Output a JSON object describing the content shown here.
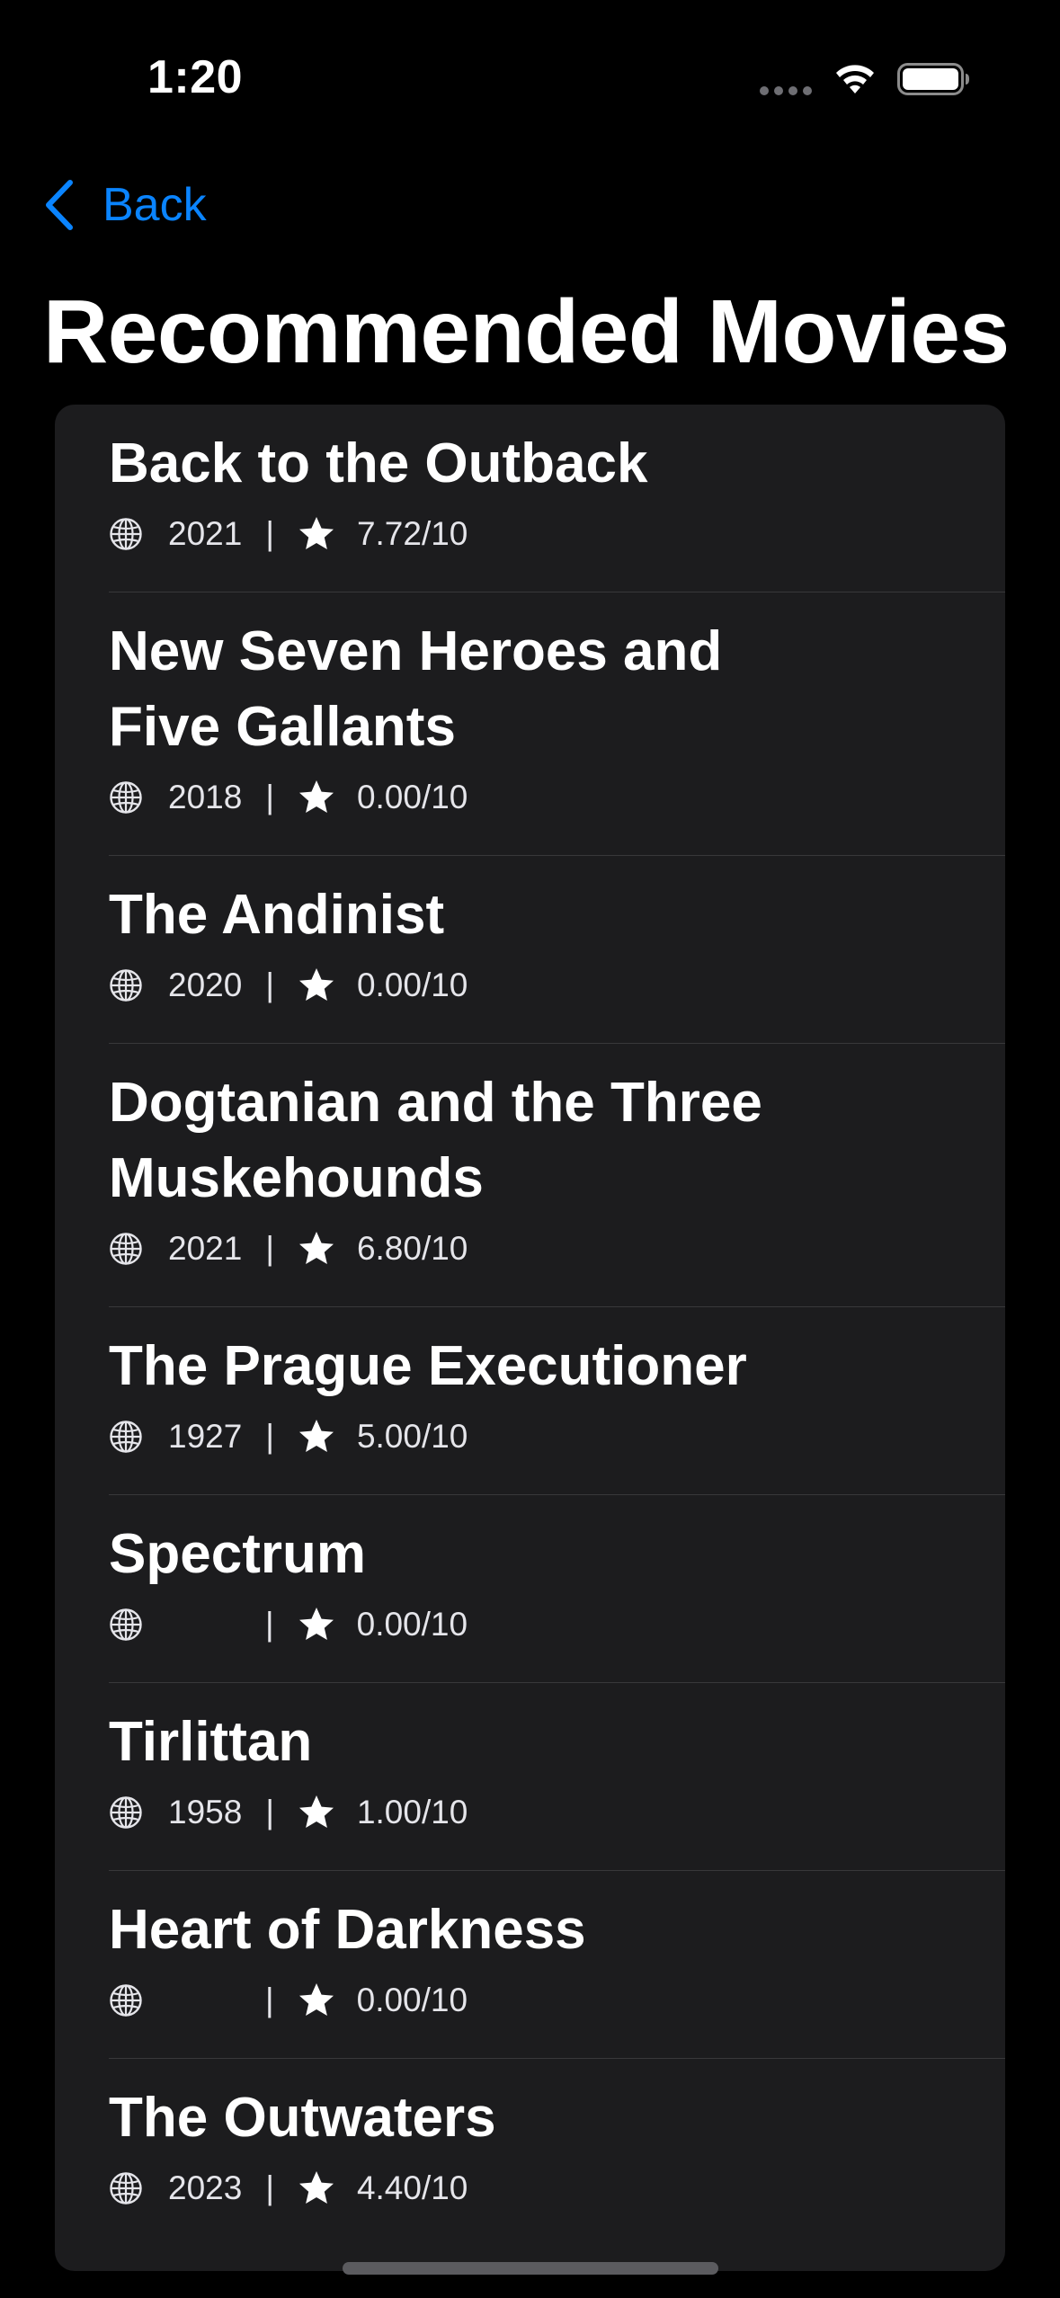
{
  "status_bar": {
    "time": "1:20"
  },
  "nav": {
    "back_label": "Back",
    "title": "Recommended Movies"
  },
  "colors": {
    "accent": "#0a84ff",
    "background": "#000000",
    "card": "#1c1c1e",
    "separator": "#38383a"
  },
  "icons": {
    "meta_left": "globe-icon",
    "meta_rating": "star-icon"
  },
  "movies": [
    {
      "title": "Back to the Outback",
      "year": "2021",
      "separator": "|",
      "rating": "7.72/10"
    },
    {
      "title": "New Seven Heroes and Five Gallants",
      "year": "2018",
      "separator": "|",
      "rating": "0.00/10"
    },
    {
      "title": "The Andinist",
      "year": "2020",
      "separator": "|",
      "rating": "0.00/10"
    },
    {
      "title": "Dogtanian and the Three Muskehounds",
      "year": "2021",
      "separator": "|",
      "rating": "6.80/10"
    },
    {
      "title": "The Prague Executioner",
      "year": "1927",
      "separator": "|",
      "rating": "5.00/10"
    },
    {
      "title": "Spectrum",
      "year": "",
      "separator": "|",
      "rating": "0.00/10"
    },
    {
      "title": "Tirlittan",
      "year": "1958",
      "separator": "|",
      "rating": "1.00/10"
    },
    {
      "title": "Heart of Darkness",
      "year": "",
      "separator": "|",
      "rating": "0.00/10"
    },
    {
      "title": "The Outwaters",
      "year": "2023",
      "separator": "|",
      "rating": "4.40/10"
    }
  ]
}
